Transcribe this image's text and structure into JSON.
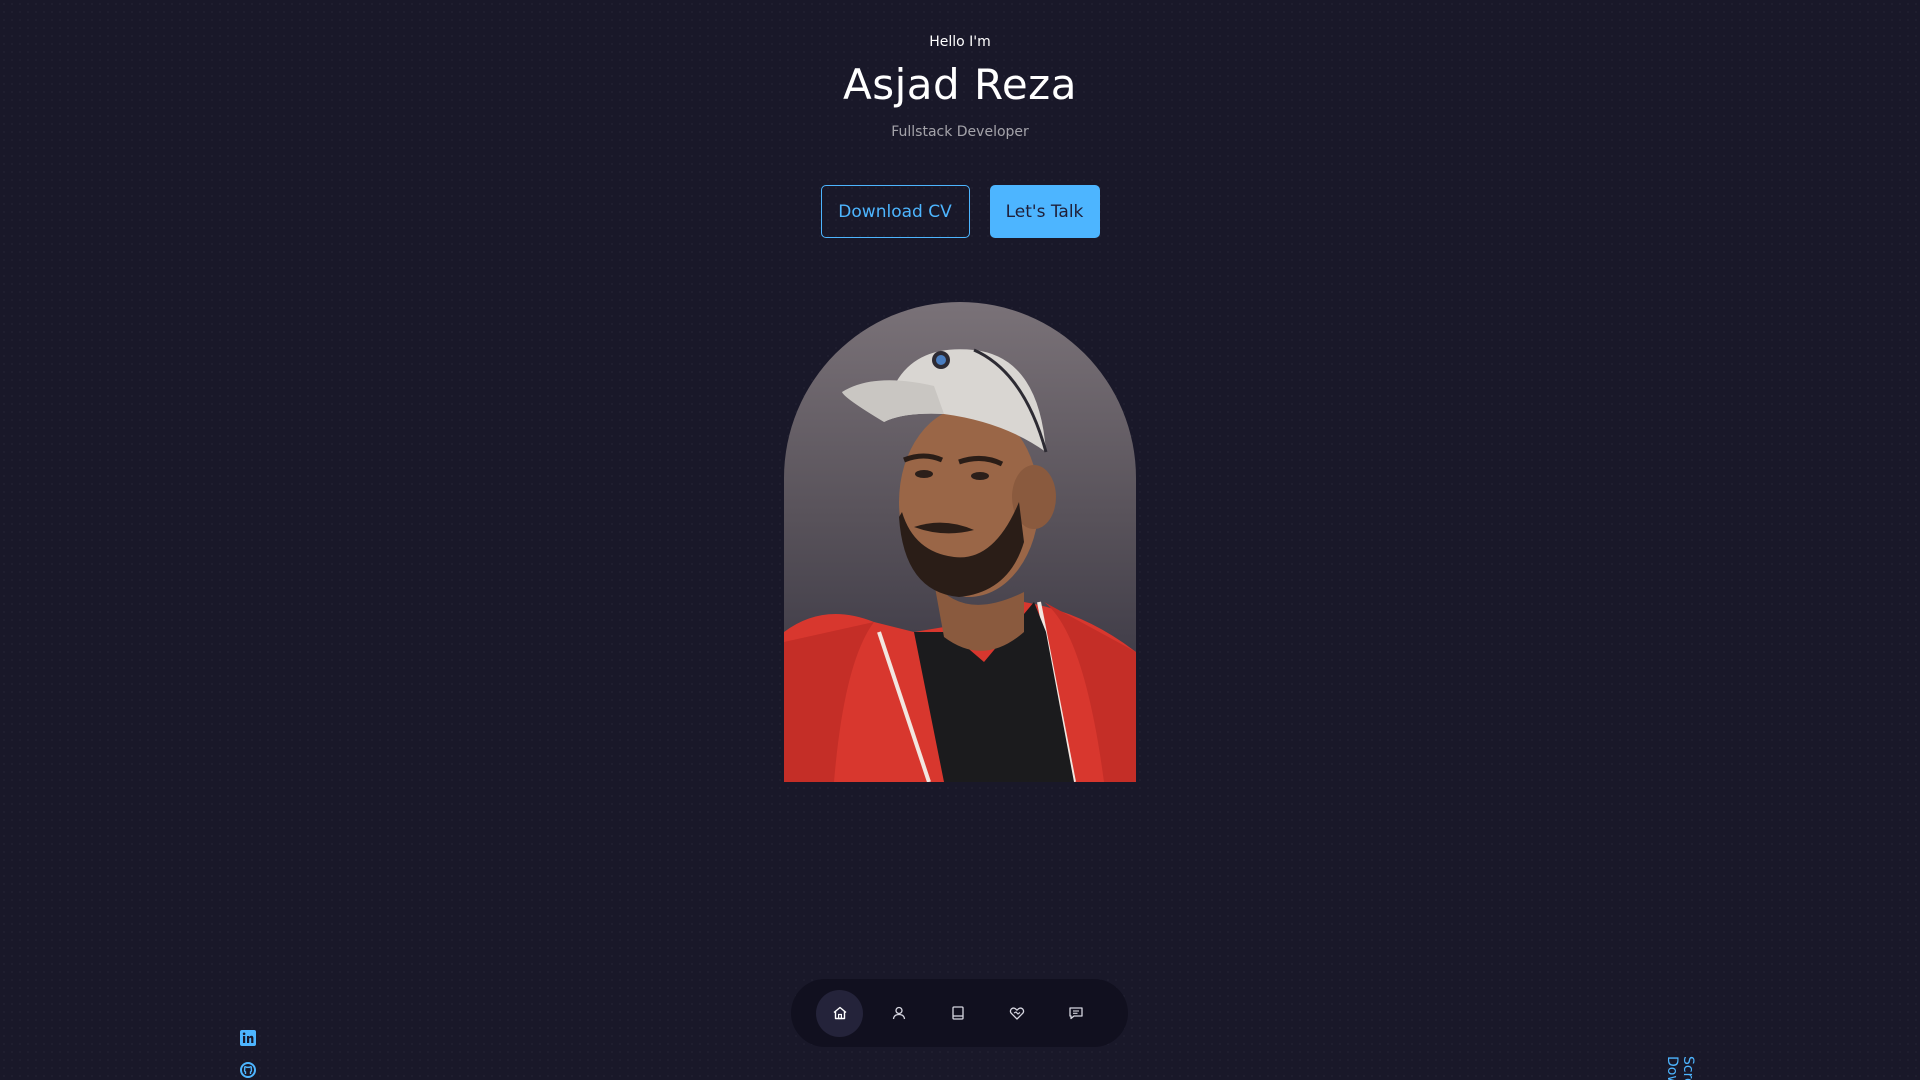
{
  "hero": {
    "greeting": "Hello I'm",
    "name": "Asjad Reza",
    "role": "Fullstack Developer"
  },
  "cta": {
    "download_label": "Download CV",
    "talk_label": "Let's Talk"
  },
  "portrait": {
    "image_description_icon": "person-portrait"
  },
  "socials": [
    {
      "icon": "linkedin-icon"
    },
    {
      "icon": "github-icon"
    }
  ],
  "scroll": {
    "label": "Scroll Down"
  },
  "nav": {
    "items": [
      {
        "icon": "home-icon",
        "active": true
      },
      {
        "icon": "user-icon",
        "active": false
      },
      {
        "icon": "book-icon",
        "active": false
      },
      {
        "icon": "services-icon",
        "active": false
      },
      {
        "icon": "message-icon",
        "active": false
      }
    ]
  },
  "colors": {
    "background": "#191829",
    "accent": "#4db5ff",
    "nav_background": "#11101f",
    "text_light": "#ffffff"
  }
}
